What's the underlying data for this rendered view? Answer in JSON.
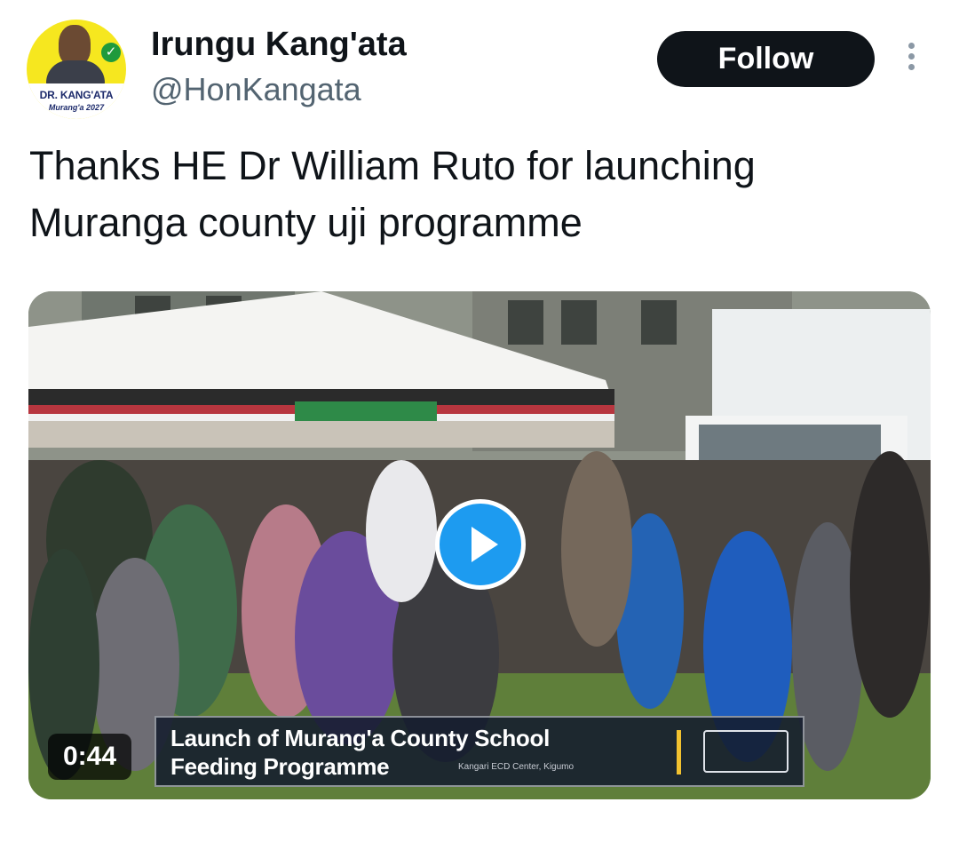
{
  "author": {
    "display_name": "Irungu Kang'ata",
    "handle": "@HonKangata",
    "avatar": {
      "logo_name": "DR. KANG'ATA",
      "logo_sub": "Murang'a 2027"
    }
  },
  "actions": {
    "follow_label": "Follow",
    "more_icon": "more-vertical-icon"
  },
  "tweet": {
    "line1": "Thanks HE Dr William Ruto for launching",
    "line2": "Muranga county uji programme"
  },
  "media": {
    "type": "video",
    "duration": "0:44",
    "play_icon": "play-icon",
    "banner": {
      "line1": "Launch of Murang'a County School",
      "line2": "Feeding Programme",
      "location": "Kangari ECD Center, Kigumo"
    }
  },
  "colors": {
    "accent": "#1d9bf0",
    "follow_bg": "#0f1419",
    "secondary_text": "#536471"
  }
}
